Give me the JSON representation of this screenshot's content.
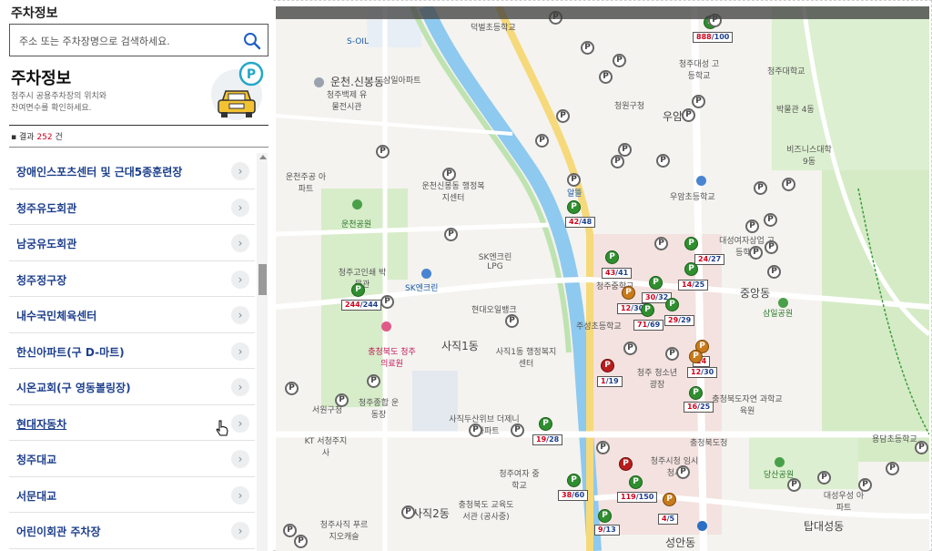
{
  "panel": {
    "header": "주차정보",
    "search_placeholder": "주소 또는 주차장명으로 검색하세요.",
    "title": "주차정보",
    "desc_line1": "청주시 공용주차장의 위치와",
    "desc_line2": "잔여면수를 확인하세요.",
    "result_prefix": "결과",
    "result_count": "252",
    "result_suffix": "건"
  },
  "list": [
    "장애인스포츠센터 및 근대5종훈련장",
    "청주유도회관",
    "남궁유도회관",
    "청주정구장",
    "내수국민체육센터",
    "한신아파트(구 D-마트)",
    "시온교회(구 영동볼링장)",
    "현대자동차",
    "청주대교",
    "서문대교",
    "어린이회관 주차장"
  ],
  "map": {
    "labels": {
      "l1": "운천.신봉동",
      "l2": "청주백제 유물전시관",
      "l3": "운천주공 아파트",
      "l4": "운천신봉동 행정복지센터",
      "l5": "운천공원",
      "l6": "청주고인쇄 박물관",
      "l7": "SK엔크린",
      "l8": "SK엔크린 LPG",
      "l9": "현대오일뱅크",
      "l10": "사직1동",
      "l11": "사직1동 행정복지센터",
      "l12": "충청북도 청주의료원",
      "l13": "청주종합 운동장",
      "l14": "서원구청",
      "l15": "KT 서청주지사",
      "l16": "사직두산위브 더제니스아파트",
      "l17": "청주여자 중학교",
      "l18": "사직2동",
      "l19": "충청북도 교육도서관 (공사중)",
      "l20": "청주사직 푸르지오캐슬",
      "l21": "덕벌초등학교",
      "l22": "삼일아파트",
      "l23": "S-OIL",
      "l24": "알뜰",
      "l25": "청원구청",
      "l26": "청주대성 고등학교",
      "l27": "청주대학교",
      "l28": "박물관 4동",
      "l29": "비즈니스대학 9동",
      "l30": "우암초등학교",
      "l31": "대성여자상업 고등학교",
      "l32": "중앙동",
      "l33": "삼일공원",
      "l34": "주성초등학교",
      "l35": "청주 청소년광장",
      "l36": "충청북도자연 과학교육원",
      "l37": "충청북도청",
      "l38": "청주시청 임시청사",
      "l39": "당산공원",
      "l40": "대성우성 아파트",
      "l41": "탑대성동",
      "l42": "성안동",
      "l43": "용담초등학교",
      "l44": "우암동",
      "l45": "청주중학교"
    },
    "badges": {
      "b1": [
        "888",
        "100"
      ],
      "b2": [
        "42",
        "48"
      ],
      "b3": [
        "43",
        "41"
      ],
      "b4": [
        "24",
        "27"
      ],
      "b5": [
        "14",
        "25"
      ],
      "b6": [
        "30",
        "32"
      ],
      "b7": [
        "12",
        "30"
      ],
      "b8": [
        "71",
        "69"
      ],
      "b9": [
        "29",
        "29"
      ],
      "b10": [
        "244",
        "244"
      ],
      "b11": [
        "1",
        "19"
      ],
      "b12": [
        "12",
        "30"
      ],
      "b13": [
        "24",
        ""
      ],
      "b14": [
        "16",
        "25"
      ],
      "b15": [
        "19",
        "28"
      ],
      "b16": [
        "38",
        "60"
      ],
      "b17": [
        "119",
        "150"
      ],
      "b18": [
        "9",
        "13"
      ],
      "b19": [
        "4",
        "5"
      ]
    }
  },
  "colors": {
    "accent_blue": "#1d3f8c",
    "count_red": "#d0021b",
    "pin_green": "#2f8f2f",
    "pin_orange": "#c97a1a",
    "pin_red": "#b81e1e",
    "river": "#8ec9ef",
    "main_road": "#f6d97a"
  }
}
